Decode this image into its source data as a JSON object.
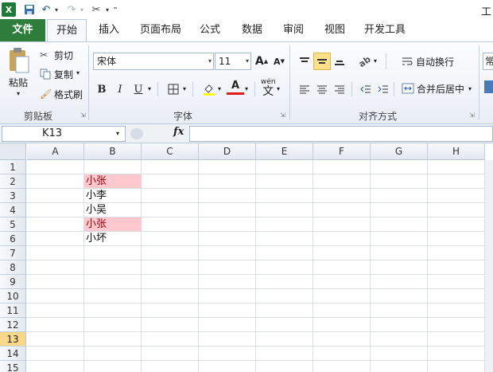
{
  "qat": {
    "app_title": "工",
    "excel_icon": "excel-icon",
    "save_icon": "save-icon",
    "undo_icon": "undo-icon",
    "redo_icon": "redo-icon",
    "customize_icon": "customize-icon"
  },
  "tabs": [
    "文件",
    "开始",
    "插入",
    "页面布局",
    "公式",
    "数据",
    "审阅",
    "视图",
    "开发工具"
  ],
  "ribbon": {
    "clipboard": {
      "paste": "粘贴",
      "cut": "剪切",
      "copy": "复制",
      "format_painter": "格式刷",
      "label": "剪贴板"
    },
    "font": {
      "font_name": "宋体",
      "font_size": "11",
      "grow": "A",
      "shrink": "A",
      "bold": "B",
      "italic": "I",
      "underline": "U",
      "font_color_letter": "A",
      "phonetic": "wén",
      "phonetic_char": "文",
      "label": "字体"
    },
    "alignment": {
      "wrap_text": "自动换行",
      "merge_center": "合并后居中",
      "label": "对齐方式",
      "next_group_partial": "常"
    },
    "colors": {
      "file_tab": "#2e7d3a",
      "highlight_fill": "#ffc7ce",
      "highlight_text": "#9c0006",
      "selected_row": "#f9d88a"
    }
  },
  "formula_bar": {
    "name_box": "K13",
    "fx": "fx",
    "formula": ""
  },
  "grid": {
    "columns": [
      "A",
      "B",
      "C",
      "D",
      "E",
      "F",
      "G",
      "H"
    ],
    "rows": [
      "1",
      "2",
      "3",
      "4",
      "5",
      "6",
      "7",
      "8",
      "9",
      "10",
      "11",
      "12",
      "13",
      "14",
      "15"
    ],
    "selected_row": "13",
    "cells": {
      "B2": "小张",
      "B3": "小李",
      "B4": "小吴",
      "B5": "小张",
      "B6": "小坏"
    },
    "highlighted_cells": [
      "B2",
      "B5"
    ]
  }
}
